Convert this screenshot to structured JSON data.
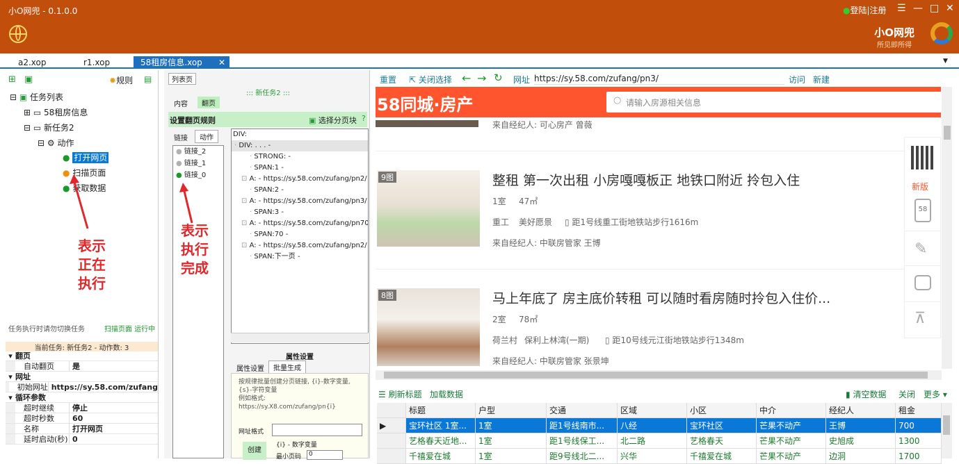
{
  "app": {
    "title": "小O网兜 - 0.1.0.0",
    "login": "登陆|注册",
    "brand": "小O网兜",
    "slogan": "所见即所得"
  },
  "tabs": [
    {
      "label": "a2.xop"
    },
    {
      "label": "r1.xop"
    },
    {
      "label": "58租房信息.xop"
    }
  ],
  "left": {
    "rules_label": "规则",
    "tree": {
      "root": "任务列表",
      "task1": "58租房信息",
      "task2": "新任务2",
      "actions": "动作",
      "a1": "打开网页",
      "a2": "扫描页面",
      "a3": "获取数据"
    },
    "hint": "任务执行时请勿切换任务",
    "status": "扫描页面 运行中",
    "current": "当前任务: 新任务2 - 动作数: 3",
    "props": [
      {
        "k": "翻页",
        "v": "",
        "group": true
      },
      {
        "k": "自动翻页",
        "v": "是"
      },
      {
        "k": "网址",
        "v": "",
        "group": true
      },
      {
        "k": "初始网址",
        "v": "https://sy.58.com/zufang"
      },
      {
        "k": "循环参数",
        "v": "",
        "group": true
      },
      {
        "k": "超时继续",
        "v": "停止"
      },
      {
        "k": "超时秒数",
        "v": "60"
      },
      {
        "k": "名称",
        "v": "打开网页"
      },
      {
        "k": "延时启动(秒)",
        "v": "0"
      }
    ],
    "anno": "表示\n正在\n执行"
  },
  "mid": {
    "tab": "列表页",
    "subhead": "::: 新任务2 :::",
    "inner_tab1": "内容",
    "inner_tab2": "翻页",
    "section": "设置翻页规则",
    "select_block": "选择分页块",
    "links_tab": "链接",
    "action_tab": "动作",
    "links": [
      {
        "label": "链接_2",
        "color": "#b0b0b0"
      },
      {
        "label": "链接_1",
        "color": "#b0b0b0"
      },
      {
        "label": "链接_0",
        "color": "#1a9a2a"
      }
    ],
    "dom": [
      "DIV:",
      "DIV: . . . -",
      "STRONG: -",
      "SPAN:1 -",
      "A: - https://sy.58.com/zufang/pn2/",
      "SPAN:2 -",
      "A: - https://sy.58.com/zufang/pn3/",
      "SPAN:3 -",
      "A: - https://sy.58.com/zufang/pn70/",
      "SPAN:70 -",
      "A: - https://sy.58.com/zufang/pn2/",
      "SPAN:下一页 -"
    ],
    "attr_title": "属性设置",
    "attr_tab1": "属性设置",
    "attr_tab2": "批量生成",
    "attr_desc": "按规律批量创建分页链接, {i}-数字变量, {s}-字符变量\n例如格式:\nhttps://sy.X8.com/zufang/pn{i}",
    "url_format": "网址格式",
    "var_label": "{i} - 数字变量",
    "create": "创建",
    "min_label": "最小页码",
    "min_val": "0",
    "anno": "表示\n执行\n完成"
  },
  "browser": {
    "reset": "重置",
    "close_select": "关闭选择",
    "addr_label": "网址",
    "url": "https://sy.58.com/zufang/pn3/",
    "visit": "访问",
    "new": "新建",
    "site_logo": "58同城·房产",
    "search_ph": "请输入房源相关信息",
    "prev_agent": "来自经纪人: 可心房产 曾薇",
    "listings": [
      {
        "badge": "9图",
        "title": "整租 第一次出租 小房嘎嘎板正 地铁口附近 拎包入住",
        "room": "1室",
        "area": "47㎡",
        "loc1": "重工",
        "loc2": "美好愿景",
        "dist": "距1号线重工街地铁站步行1616m",
        "agent": "来自经纪人: 中联房管家 王博"
      },
      {
        "badge": "8图",
        "title": "马上年底了 房主底价转租 可以随时看房随时拎包入住价...",
        "room": "2室",
        "area": "78㎡",
        "loc1": "荷兰村",
        "loc2": "保利上林湾(一期)",
        "dist": "距10号线元江街地铁站步行1348m",
        "agent": "来自经纪人: 中联房管家 张景坤"
      }
    ],
    "side": {
      "new_version": "新版"
    },
    "refresh": "刷新标题",
    "load": "加载数据",
    "clear": "清空数据",
    "close": "关闭",
    "more": "更多",
    "cols": [
      "标题",
      "户型",
      "交通",
      "区域",
      "小区",
      "中介",
      "经纪人",
      "租金"
    ],
    "rows": [
      [
        "宝环社区 1室...",
        "1室",
        "距1号线南市...",
        "八经",
        "宝环社区",
        "芒果不动产",
        "王博",
        "700"
      ],
      [
        "艺格春天近地...",
        "1室",
        "距1号线保工...",
        "北二路",
        "艺格春天",
        "芒果不动产",
        "史旭成",
        "1300"
      ],
      [
        "千禧爱在城",
        "1室",
        "距9号线北二...",
        "兴华",
        "千禧爱在城",
        "芒果不动产",
        "边洞",
        "1700"
      ]
    ]
  },
  "colors": {
    "accent": "#c24e0c",
    "tabblue": "#1f6fbf",
    "site_orange": "#ff552e",
    "select": "#0a78d7"
  }
}
